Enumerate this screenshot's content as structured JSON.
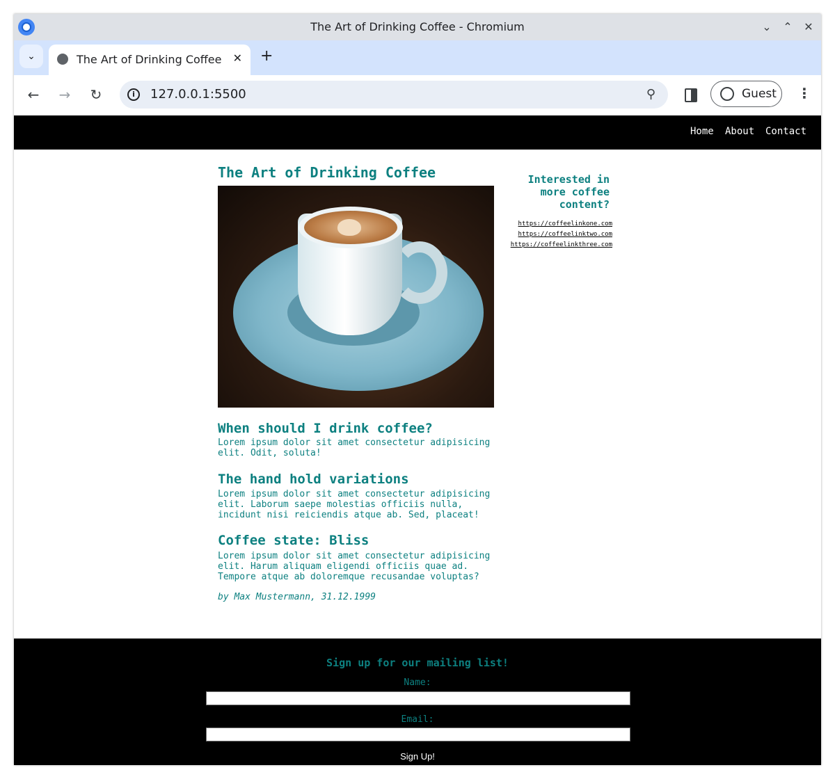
{
  "browser": {
    "window_title": "The Art of Drinking Coffee - Chromium",
    "tab_title": "The Art of Drinking Coffee",
    "url": "127.0.0.1:5500",
    "profile_label": "Guest"
  },
  "nav": {
    "items": [
      "Home",
      "About",
      "Contact"
    ]
  },
  "article": {
    "title": "The Art of Drinking Coffee",
    "image_alt": "coffee cup on saucer",
    "sections": [
      {
        "heading": "When should I drink coffee?",
        "text": "Lorem ipsum dolor sit amet consectetur adipisicing elit. Odit, soluta!"
      },
      {
        "heading": "The hand hold variations",
        "text": "Lorem ipsum dolor sit amet consectetur adipisicing elit. Laborum saepe molestias officiis nulla, incidunt nisi reiciendis atque ab. Sed, placeat!"
      },
      {
        "heading": "Coffee state: Bliss",
        "text": "Lorem ipsum dolor sit amet consectetur adipisicing elit. Harum aliquam eligendi officiis quae ad. Tempore atque ab doloremque recusandae voluptas?"
      }
    ],
    "byline": "by Max Mustermann, 31.12.1999"
  },
  "aside": {
    "heading": "Interested in more coffee content?",
    "links": [
      "https://coffeelinkone.com",
      "https://coffeelinktwo.com",
      "https://coffeelinkthree.com"
    ]
  },
  "footer": {
    "heading": "Sign up for our mailing list!",
    "name_label": "Name:",
    "email_label": "Email:",
    "name_value": "",
    "email_value": "",
    "submit_label": "Sign Up!"
  },
  "colors": {
    "accent": "#0d8080",
    "nav_bg": "#000000",
    "tabstrip_bg": "#d3e3fd"
  }
}
